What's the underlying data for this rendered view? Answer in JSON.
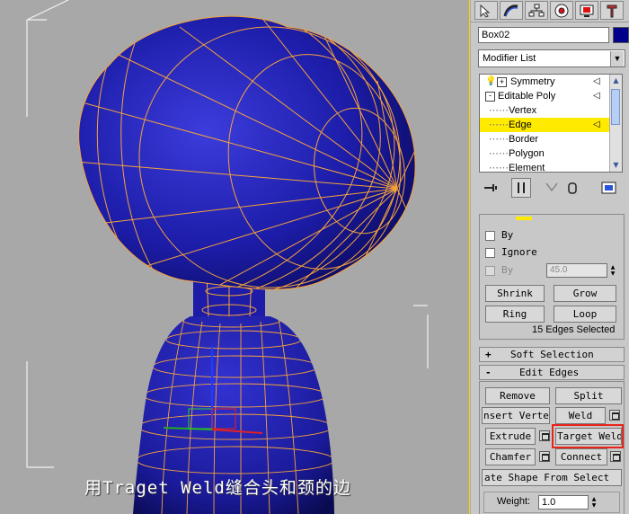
{
  "viewport": {
    "subtitle": "用Traget Weld缝合头和颈的边"
  },
  "panel": {
    "tabs": [
      {
        "icon": "create-icon"
      },
      {
        "icon": "modify-icon"
      },
      {
        "icon": "hierarchy-icon"
      },
      {
        "icon": "motion-icon"
      },
      {
        "icon": "display-icon"
      },
      {
        "icon": "utilities-icon"
      }
    ],
    "object_name": "Box02",
    "object_color": "#00008b",
    "modifier_list": "Modifier List",
    "stack": [
      {
        "label": "Symmetry",
        "level": 0
      },
      {
        "label": "Editable Poly",
        "level": 0
      },
      {
        "label": "Vertex",
        "level": 1
      },
      {
        "label": "Edge",
        "level": 1,
        "selected": true
      },
      {
        "label": "Border",
        "level": 1
      },
      {
        "label": "Polygon",
        "level": 1
      },
      {
        "label": "Element",
        "level": 1
      }
    ],
    "selection": {
      "by_label": "By",
      "ignore_label": "Ignore",
      "by_angle_label": "By",
      "angle_value": "45.0",
      "shrink": "Shrink",
      "grow": "Grow",
      "ring": "Ring",
      "loop": "Loop",
      "status": "15 Edges Selected"
    },
    "soft_selection": {
      "toggle": "+",
      "title": "Soft Selection"
    },
    "edit_edges": {
      "toggle": "-",
      "title": "Edit Edges",
      "remove": "Remove",
      "split": "Split",
      "insert_vertex": "nsert Verte",
      "weld": "Weld",
      "extrude": "Extrude",
      "target_weld": "Target Weld",
      "chamfer": "Chamfer",
      "connect": "Connect",
      "create_shape": "ate Shape From Select",
      "weight_label": "Weight:",
      "weight_value": "1.0"
    },
    "accent_color": "#ffea00",
    "highlight_color": "#e8241c"
  }
}
